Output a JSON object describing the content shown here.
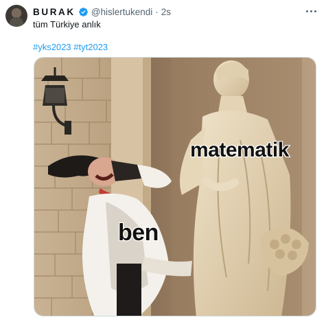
{
  "tweet": {
    "display_name": "BURAK",
    "handle": "@hislertukendi",
    "separator": "·",
    "timestamp": "2s",
    "text": "tüm Türkiye anlık",
    "hashtags": [
      "#yks2023",
      "#tyt2023"
    ]
  },
  "meme": {
    "top_label": "matematik",
    "bottom_label": "ben"
  },
  "icons": {
    "verified": "verified-badge-icon",
    "more": "more-options-icon"
  },
  "colors": {
    "accent": "#1d9bf0",
    "secondary_text": "#536471",
    "border": "#cfd9de"
  }
}
